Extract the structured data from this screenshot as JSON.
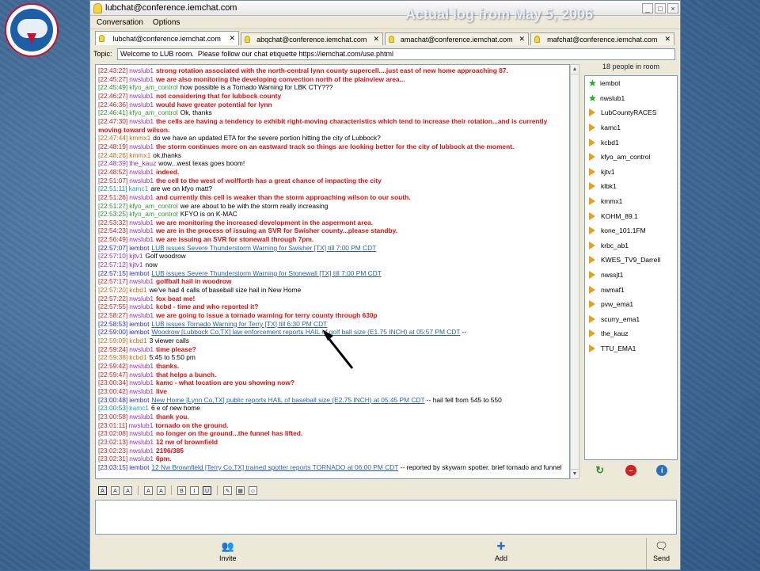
{
  "slide": {
    "caption": "Actual log from May 5, 2006",
    "logo_text": "NATIONAL WEATHER SERVICE"
  },
  "window": {
    "title": "lubchat@conference.iemchat.com",
    "menu": [
      "Conversation",
      "Options"
    ],
    "tabs": [
      {
        "label": "lubchat@conference.iemchat.com",
        "active": true
      },
      {
        "label": "abqchat@conference.iemchat.com",
        "active": false
      },
      {
        "label": "amachat@conference.iemchat.com",
        "active": false
      },
      {
        "label": "mafchat@conference.iemchat.com",
        "active": false
      }
    ],
    "topic_label": "Topic:",
    "topic_value": "Welcome to LUB room.  Please follow our chat etiquette https://iemchat.com/use.phtml"
  },
  "log": [
    {
      "ts": "[22:43:22]",
      "tsc": "red",
      "nick": "nwslub1",
      "nc": "nws",
      "msg": "strong rotation associated with the north-central lynn county supercell....just east of new home approaching 87.",
      "mc": "red"
    },
    {
      "ts": "[22:45:27]",
      "tsc": "red",
      "nick": "nwslub1",
      "nc": "nws",
      "msg": "we are also monitoring the developing convection north of the plainview area...",
      "mc": "red"
    },
    {
      "ts": "[22:45:49]",
      "tsc": "green",
      "nick": "kfyo_am_control",
      "nc": "kfyo",
      "msg": "how possible is a Tornado Warning for LBK CTY???",
      "mc": ""
    },
    {
      "ts": "[22:46:27]",
      "tsc": "red",
      "nick": "nwslub1",
      "nc": "nws",
      "msg": "not considering that for lubbock county",
      "mc": "red"
    },
    {
      "ts": "[22:46:36]",
      "tsc": "red",
      "nick": "nwslub1",
      "nc": "nws",
      "msg": "would have greater potential for lynn",
      "mc": "red"
    },
    {
      "ts": "[22:46:41]",
      "tsc": "green",
      "nick": "kfyo_am_control",
      "nc": "kfyo",
      "msg": "Ok, thanks",
      "mc": ""
    },
    {
      "ts": "[22:47:30]",
      "tsc": "red",
      "nick": "nwslub1",
      "nc": "nws",
      "msg": "the cells are having a tendency to exhibit right-moving characteristics which tend to increase their rotation...and is currently moving  toward wilson.",
      "mc": "red",
      "wrap": true
    },
    {
      "ts": "[22:47:44]",
      "tsc": "orange",
      "nick": "kmmx1",
      "nc": "kmmx",
      "msg": "do we have an updated ETA for the severe portion hitting the city of Lubbock?",
      "mc": ""
    },
    {
      "ts": "[22:48:19]",
      "tsc": "red",
      "nick": "nwslub1",
      "nc": "nws",
      "msg": "the storm continues more on an eastward track so things are looking better for the city of lubbock at the moment.",
      "mc": "red"
    },
    {
      "ts": "[22:48:26]",
      "tsc": "orange",
      "nick": "kmmx1",
      "nc": "kmmx",
      "msg": "ok,thanks",
      "mc": ""
    },
    {
      "ts": "[22:48:39]",
      "tsc": "purple",
      "nick": "the_kauz",
      "nc": "kauz",
      "msg": "wow...west texas goes boom!",
      "mc": ""
    },
    {
      "ts": "[22:48:52]",
      "tsc": "red",
      "nick": "nwslub1",
      "nc": "nws",
      "msg": "indeed.",
      "mc": "red"
    },
    {
      "ts": "[22:51:07]",
      "tsc": "red",
      "nick": "nwslub1",
      "nc": "nws",
      "msg": "the cell to the west of wolfforth has a great chance of impacting the city",
      "mc": "red"
    },
    {
      "ts": "[22:51:11]",
      "tsc": "teal",
      "nick": "kamc1",
      "nc": "kamc",
      "msg": "are we on kfyo matt?",
      "mc": ""
    },
    {
      "ts": "[22:51:26]",
      "tsc": "red",
      "nick": "nwslub1",
      "nc": "nws",
      "msg": "and currently this cell is weaker than the storm approaching wilson to our south.",
      "mc": "red"
    },
    {
      "ts": "[22:51:27]",
      "tsc": "green",
      "nick": "kfyo_am_control",
      "nc": "kfyo",
      "msg": "we are about to be with the storm really increasing",
      "mc": ""
    },
    {
      "ts": "[22:53:25]",
      "tsc": "green",
      "nick": "kfyo_am_control",
      "nc": "kfyo",
      "msg": "KFYO is on K-MAC",
      "mc": ""
    },
    {
      "ts": "[22:53:32]",
      "tsc": "red",
      "nick": "nwslub1",
      "nc": "nws",
      "msg": "we are monitoring the increased development in the aspermont area.",
      "mc": "red"
    },
    {
      "ts": "[22:54:23]",
      "tsc": "red",
      "nick": "nwslub1",
      "nc": "nws",
      "msg": "we are in the process of issuing an SVR for Swisher county...please standby.",
      "mc": "red"
    },
    {
      "ts": "[22:56:49]",
      "tsc": "red",
      "nick": "nwslub1",
      "nc": "nws",
      "msg": "we are issuing an SVR for stonewall through 7pm.",
      "mc": "red"
    },
    {
      "ts": "[22:57:07]",
      "tsc": "",
      "nick": "iembot",
      "nc": "iem",
      "msg": "LUB issues Severe Thunderstorm Warning for Swisher [TX] till 7:00 PM CDT",
      "mc": "link"
    },
    {
      "ts": "[22:57:10]",
      "tsc": "purple",
      "nick": "kjtv1",
      "nc": "kjtv",
      "msg": "Golf woodrow",
      "mc": ""
    },
    {
      "ts": "[22:57:12]",
      "tsc": "purple",
      "nick": "kjtv1",
      "nc": "kjtv",
      "msg": "now",
      "mc": ""
    },
    {
      "ts": "[22:57:15]",
      "tsc": "",
      "nick": "iembot",
      "nc": "iem",
      "msg": "LUB issues Severe Thunderstorm Warning for Stonewall [TX] till 7:00 PM CDT",
      "mc": "link"
    },
    {
      "ts": "[22:57:17]",
      "tsc": "red",
      "nick": "nwslub1",
      "nc": "nws",
      "msg": "golfball hail in woodrow",
      "mc": "red"
    },
    {
      "ts": "[22:57:20]",
      "tsc": "orange",
      "nick": "kcbd1",
      "nc": "kcbd",
      "msg": "we've had 4 calls of baseball size hail in New Home",
      "mc": ""
    },
    {
      "ts": "[22:57:22]",
      "tsc": "red",
      "nick": "nwslub1",
      "nc": "nws",
      "msg": "fox beat me!",
      "mc": "red"
    },
    {
      "ts": "[22:57:55]",
      "tsc": "red",
      "nick": "nwslub1",
      "nc": "nws",
      "msg": "kcbd - time and who reported it?",
      "mc": "red"
    },
    {
      "ts": "[22:58:27]",
      "tsc": "red",
      "nick": "nwslub1",
      "nc": "nws",
      "msg": "we are going to issue a tornado warning for terry county through 630p",
      "mc": "red"
    },
    {
      "ts": "[22:58:53]",
      "tsc": "",
      "nick": "iembot",
      "nc": "iem",
      "msg": "LUB issues Tornado Warning for Terry [TX] till 6:30 PM CDT",
      "mc": "link"
    },
    {
      "ts": "[22:59:00]",
      "tsc": "",
      "nick": "iembot",
      "nc": "iem",
      "msg": "Woodrow [Lubbock Co,TX] law enforcement reports HAIL of golf ball size (E1.75 INCH) at 05:57 PM CDT",
      "mc": "link",
      "tail": " --"
    },
    {
      "ts": "[22:59:09]",
      "tsc": "orange",
      "nick": "kcbd1",
      "nc": "kcbd",
      "msg": "3 viewer calls",
      "mc": ""
    },
    {
      "ts": "[22:59:24]",
      "tsc": "red",
      "nick": "nwslub1",
      "nc": "nws",
      "msg": "time please?",
      "mc": "red"
    },
    {
      "ts": "[22:59:38]",
      "tsc": "orange",
      "nick": "kcbd1",
      "nc": "kcbd",
      "msg": "5:45 to 5:50 pm",
      "mc": ""
    },
    {
      "ts": "[22:59:42]",
      "tsc": "red",
      "nick": "nwslub1",
      "nc": "nws",
      "msg": "thanks.",
      "mc": "red"
    },
    {
      "ts": "[22:59:47]",
      "tsc": "red",
      "nick": "nwslub1",
      "nc": "nws",
      "msg": "that helps a bunch.",
      "mc": "red"
    },
    {
      "ts": "[23:00:34]",
      "tsc": "red",
      "nick": "nwslub1",
      "nc": "nws",
      "msg": "kamc - what location are you showing now?",
      "mc": "red"
    },
    {
      "ts": "[23:00:42]",
      "tsc": "red",
      "nick": "nwslub1",
      "nc": "nws",
      "msg": "live",
      "mc": "red"
    },
    {
      "ts": "[23:00:48]",
      "tsc": "",
      "nick": "iembot",
      "nc": "iem",
      "msg": "New Home [Lynn Co,TX] public reports HAIL of baseball size (E2.75 INCH) at 05:45 PM CDT",
      "mc": "link",
      "tail": " -- hail fell from 545 to 550"
    },
    {
      "ts": "[23:00:53]",
      "tsc": "teal",
      "nick": "kamc1",
      "nc": "kamc",
      "msg": "6 e of new home",
      "mc": ""
    },
    {
      "ts": "[23:00:58]",
      "tsc": "red",
      "nick": "nwslub1",
      "nc": "nws",
      "msg": "thank you.",
      "mc": "red"
    },
    {
      "ts": "[23:01:11]",
      "tsc": "red",
      "nick": "nwslub1",
      "nc": "nws",
      "msg": "tornado on the ground.",
      "mc": "red"
    },
    {
      "ts": "[23:02:08]",
      "tsc": "red",
      "nick": "nwslub1",
      "nc": "nws",
      "msg": "no longer on the ground...the funnel has lifted.",
      "mc": "red"
    },
    {
      "ts": "[23:02:13]",
      "tsc": "red",
      "nick": "nwslub1",
      "nc": "nws",
      "msg": "12 nw of brownfield",
      "mc": "red"
    },
    {
      "ts": "[23:02:23]",
      "tsc": "red",
      "nick": "nwslub1",
      "nc": "nws",
      "msg": "2196/385",
      "mc": "red"
    },
    {
      "ts": "[23:02:31]",
      "tsc": "red",
      "nick": "nwslub1",
      "nc": "nws",
      "msg": "6pm.",
      "mc": "red"
    },
    {
      "ts": "[23:03:15]",
      "tsc": "",
      "nick": "iembot",
      "nc": "iem",
      "msg": "12 Nw Brownfield [Terry Co,TX] trained spotter reports TORNADO at 06:00 PM CDT",
      "mc": "link",
      "tail": " -- reported by skywarn spotter. brief tornado and funnel"
    }
  ],
  "roster": {
    "header": "18 people in room",
    "people": [
      {
        "name": "iembot",
        "icon": "star"
      },
      {
        "name": "nwslub1",
        "icon": "star"
      },
      {
        "name": "LubCountyRACES",
        "icon": "arrow"
      },
      {
        "name": "kamc1",
        "icon": "arrow"
      },
      {
        "name": "kcbd1",
        "icon": "arrow"
      },
      {
        "name": "kfyo_am_control",
        "icon": "arrow"
      },
      {
        "name": "kjtv1",
        "icon": "arrow"
      },
      {
        "name": "klbk1",
        "icon": "arrow"
      },
      {
        "name": "kmmx1",
        "icon": "arrow"
      },
      {
        "name": "KOHM_89.1",
        "icon": "arrow"
      },
      {
        "name": "kone_101.1FM",
        "icon": "arrow"
      },
      {
        "name": "krbc_ab1",
        "icon": "arrow"
      },
      {
        "name": "KWES_TV9_Darrell",
        "icon": "arrow"
      },
      {
        "name": "nwssjt1",
        "icon": "arrow"
      },
      {
        "name": "nwmaf1",
        "icon": "arrow"
      },
      {
        "name": "pvw_ema1",
        "icon": "arrow"
      },
      {
        "name": "scurry_ema1",
        "icon": "arrow"
      },
      {
        "name": "the_kauz",
        "icon": "arrow"
      },
      {
        "name": "TTU_EMA1",
        "icon": "arrow"
      }
    ]
  },
  "bottom": {
    "invite_label": "Invite",
    "add_label": "Add",
    "send_label": "Send"
  }
}
